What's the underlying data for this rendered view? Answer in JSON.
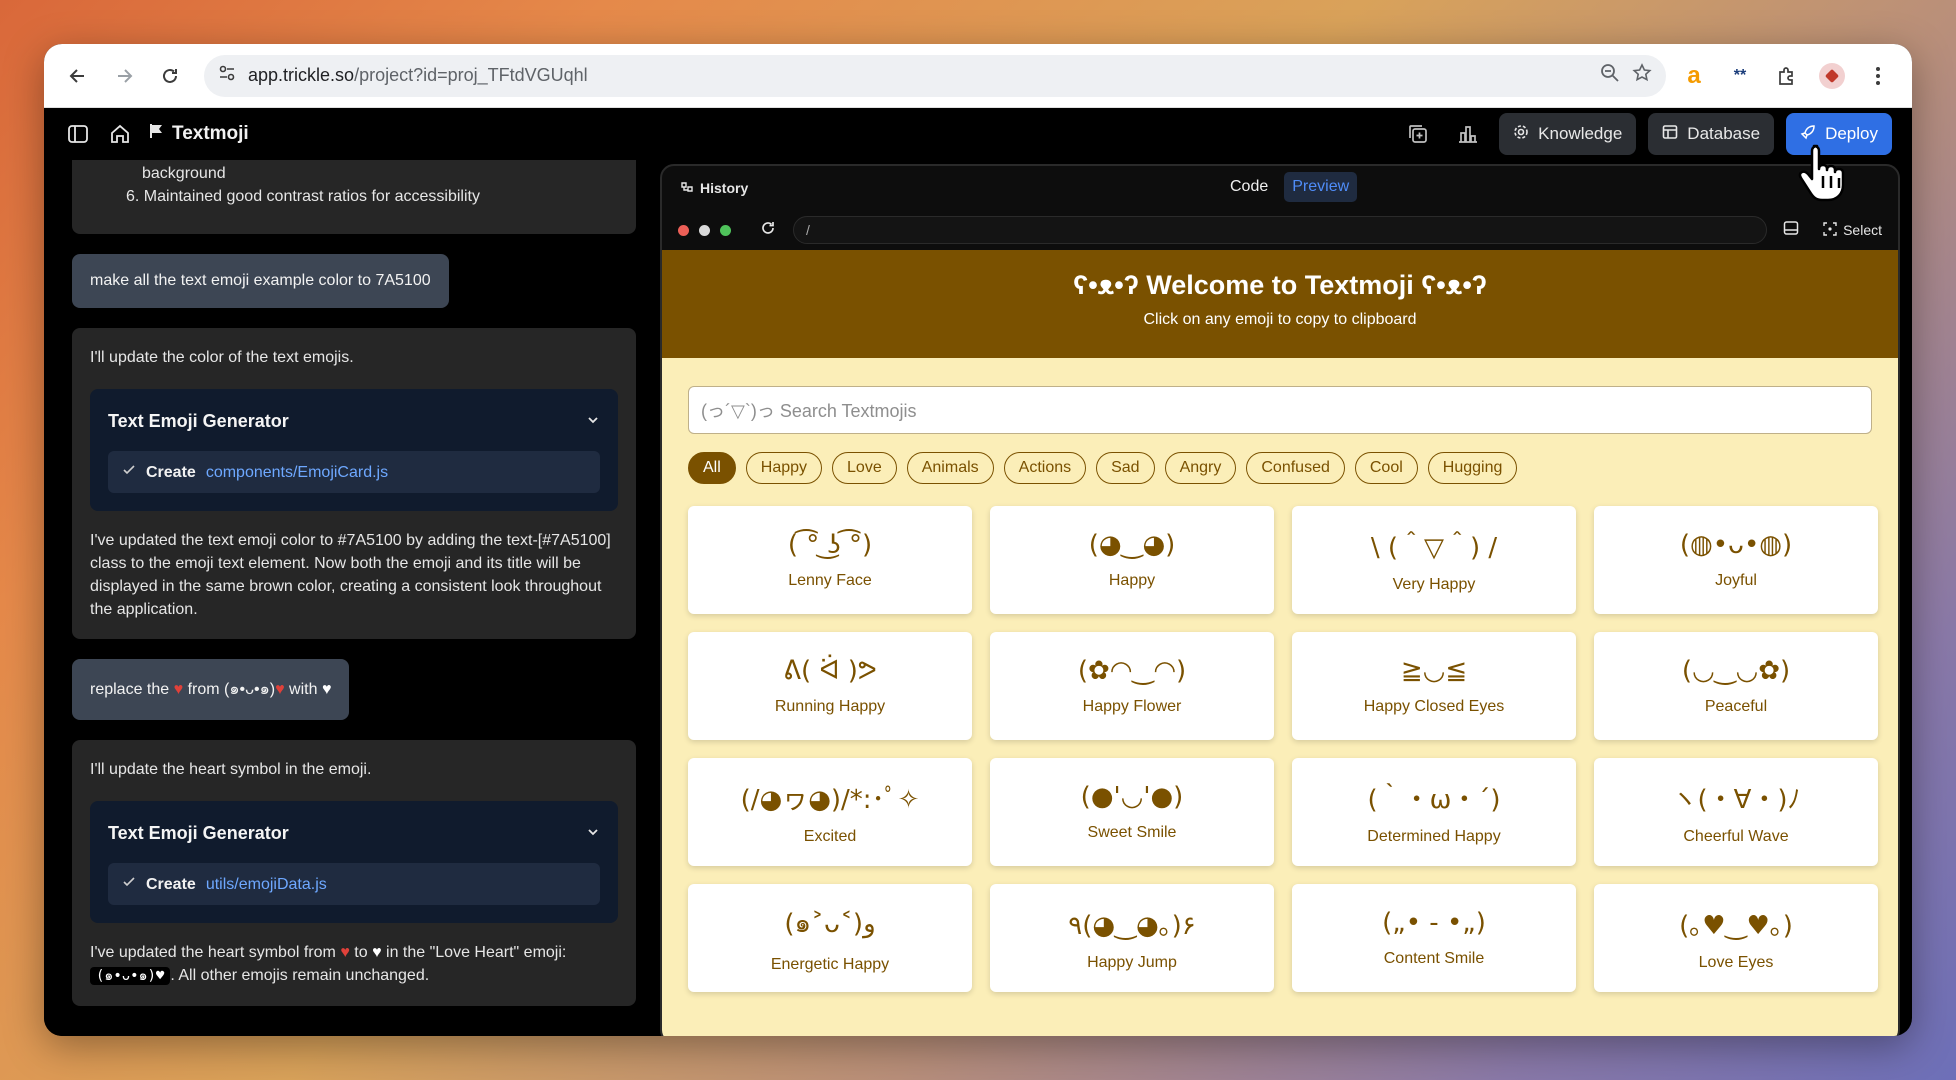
{
  "browser": {
    "url_host": "app.trickle.so",
    "url_path": "/project?id=proj_TFtdVGUqhl"
  },
  "header": {
    "app_name": "Textmoji",
    "knowledge_label": "Knowledge",
    "database_label": "Database",
    "deploy_label": "Deploy"
  },
  "chat": {
    "msg1_line1": "background",
    "msg1_line2": "6. Maintained good contrast ratios for accessibility",
    "user1": "make all the text emoji example color to 7A5100",
    "ai2_intro": "I'll update the color of the text emojis.",
    "tool1_title": "Text Emoji Generator",
    "tool1_action": "Create",
    "tool1_path": "components/EmojiCard.js",
    "ai2_body": "I've updated the text emoji color to #7A5100 by adding the text-[#7A5100] class to the emoji text element. Now both the emoji and its title will be displayed in the same brown color, creating a consistent look throughout the application.",
    "user2_a": "replace the",
    "user2_b": "from (๑•ᴗ•๑)",
    "user2_c": "with",
    "ai3_intro": "I'll update the heart symbol in the emoji.",
    "tool2_title": "Text Emoji Generator",
    "tool2_action": "Create",
    "tool2_path": "utils/emojiData.js",
    "ai3_body_a": "I've updated the heart symbol from",
    "ai3_body_b": "to",
    "ai3_body_c": "in the \"Love Heart\" emoji:",
    "ai3_code": "(๑•ᴗ•๑)♥",
    "ai3_body_d": ". All other emojis remain unchanged."
  },
  "preview": {
    "history_label": "History",
    "code_tab": "Code",
    "preview_tab": "Preview",
    "address": "/",
    "select_label": "Select"
  },
  "site": {
    "title": "ʕ•ᴥ•ʔ Welcome to Textmoji ʕ•ᴥ•ʔ",
    "subtitle": "Click on any emoji to copy to clipboard",
    "search_placeholder": "(っ´▽`)っ Search Textmojis",
    "filters": [
      "All",
      "Happy",
      "Love",
      "Animals",
      "Actions",
      "Sad",
      "Angry",
      "Confused",
      "Cool",
      "Hugging"
    ],
    "cards": [
      {
        "emoji": "( ͡° ͜ʖ ͡°)",
        "name": "Lenny Face"
      },
      {
        "emoji": "(◕‿◕)",
        "name": "Happy"
      },
      {
        "emoji": "\\ (＾▽＾) /",
        "name": "Very Happy"
      },
      {
        "emoji": "(◍•ᴗ•◍)",
        "name": "Joyful"
      },
      {
        "emoji": "ᕕ( ᐛ )ᕗ",
        "name": "Running Happy"
      },
      {
        "emoji": "(✿◠‿◠)",
        "name": "Happy Flower"
      },
      {
        "emoji": "≧◡≦",
        "name": "Happy Closed Eyes"
      },
      {
        "emoji": "(◡‿◡✿)",
        "name": "Peaceful"
      },
      {
        "emoji": "(/◕ヮ◕)/*:･ﾟ✧",
        "name": "Excited"
      },
      {
        "emoji": "(●'◡'●)",
        "name": "Sweet Smile"
      },
      {
        "emoji": "(｀・ω・´)",
        "name": "Determined Happy"
      },
      {
        "emoji": "ヽ(・∀・)ﾉ",
        "name": "Cheerful Wave"
      },
      {
        "emoji": "(๑˃ᴗ˂)ﻭ",
        "name": "Energetic Happy"
      },
      {
        "emoji": "٩(◕‿◕｡)۶",
        "name": "Happy Jump"
      },
      {
        "emoji": "(„• - •„)",
        "name": "Content Smile"
      },
      {
        "emoji": "(｡♥‿♥｡)",
        "name": "Love Eyes"
      }
    ]
  },
  "colors": {
    "brand_brown": "#7A5100",
    "site_bg": "#FBEEB8",
    "deploy_blue": "#2F6FE4"
  }
}
